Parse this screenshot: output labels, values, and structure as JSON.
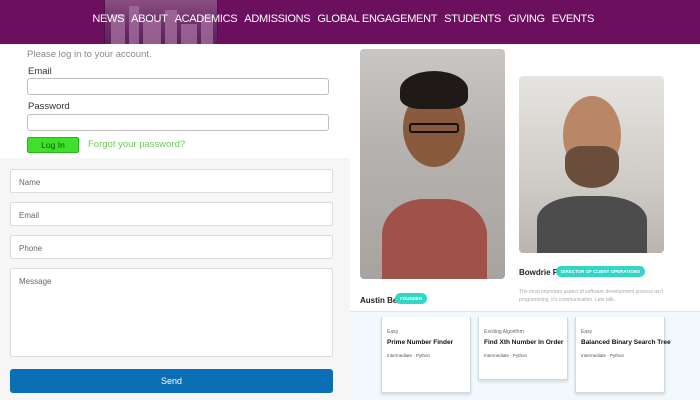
{
  "nav": {
    "items": [
      "NEWS",
      "ABOUT",
      "ACADEMICS",
      "ADMISSIONS",
      "GLOBAL ENGAGEMENT",
      "STUDENTS",
      "GIVING",
      "EVENTS"
    ]
  },
  "login": {
    "hint": "Please log in to your account.",
    "email_label": "Email",
    "password_label": "Password",
    "button_label": "Log In",
    "forgot_label": "Forgot your password?"
  },
  "contact": {
    "name_placeholder": "Name",
    "email_placeholder": "Email",
    "phone_placeholder": "Phone",
    "message_placeholder": "Message",
    "send_label": "Send"
  },
  "people": [
    {
      "name": "Austin Betzer",
      "role": "FOUNDER"
    },
    {
      "name": "Bowdrie Price",
      "role": "DIRECTOR OF CLIENT OPERATIONS",
      "bio": "The most important aspect of software development process isn't programming, it's communication. Lets talk."
    }
  ],
  "cards": [
    {
      "difficulty": "Easy",
      "title": "Prime Number Finder",
      "meta": "Intermediate · Python"
    },
    {
      "difficulty": "Exciting Algorithm",
      "title": "Find Xth Number In Order",
      "meta": "Intermediate · Python"
    },
    {
      "difficulty": "Easy",
      "title": "Balanced Binary Search Tree",
      "meta": "Intermediate · Python"
    }
  ],
  "colors": {
    "header_bg": "#6b0f5e",
    "login_button": "#3ee02a",
    "forgot_link": "#6ccc58",
    "send_button": "#0b6fb6",
    "badge": "#2fd7c4"
  }
}
